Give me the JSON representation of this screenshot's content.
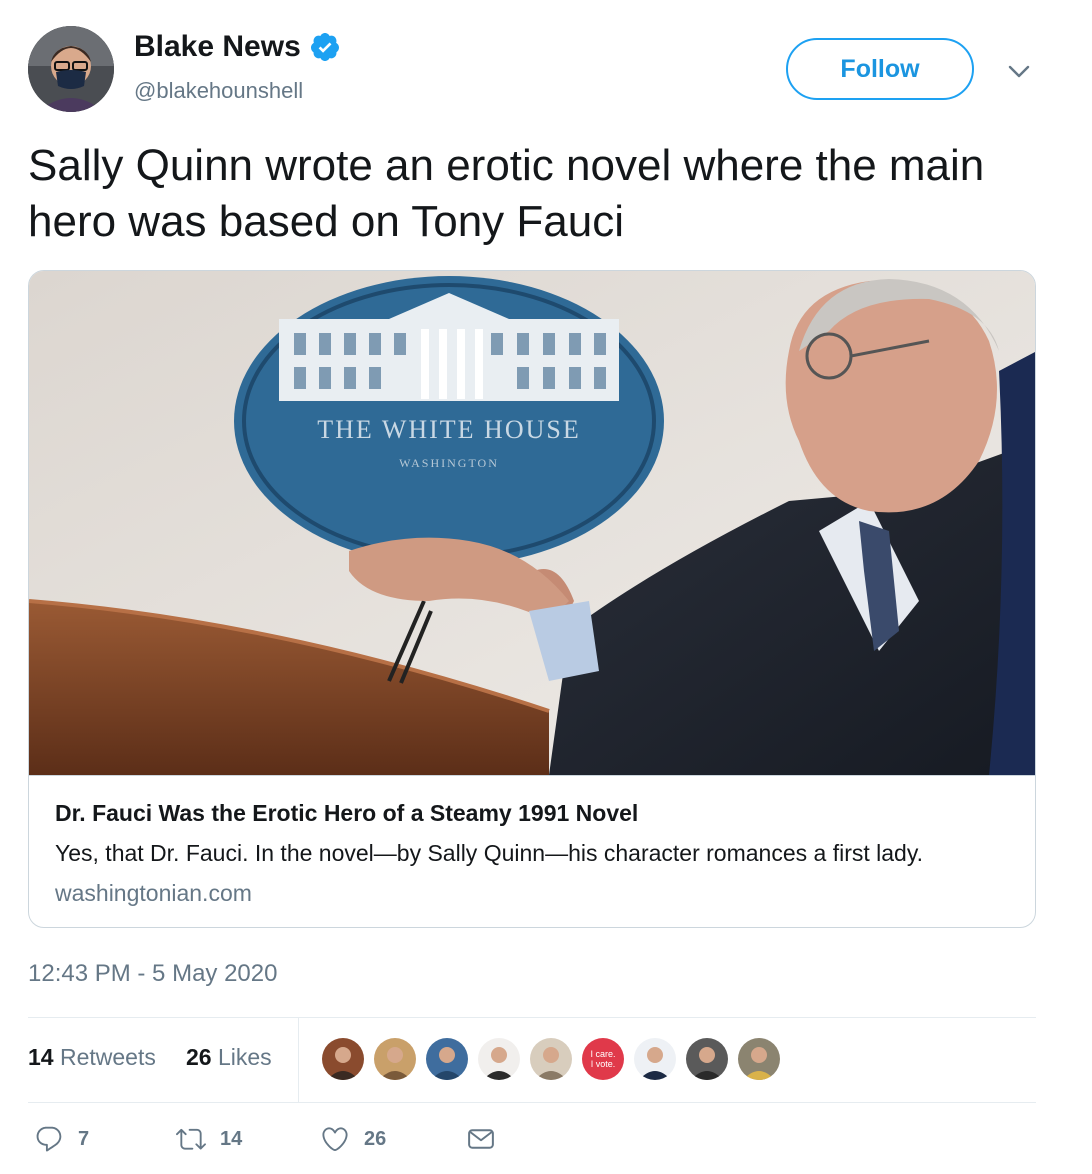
{
  "author": {
    "display_name": "Blake News",
    "handle": "@blakehounshell",
    "verified_icon": "verified-badge-icon",
    "avatar_icon": "profile-avatar"
  },
  "follow_button": {
    "label": "Follow"
  },
  "menu": {
    "icon": "chevron-down-icon"
  },
  "tweet": {
    "text": "Sally Quinn wrote an erotic novel where the main hero was based on Tony Fauci"
  },
  "card": {
    "image_sign_text": "THE WHITE HOUSE",
    "image_sign_subtext": "WASHINGTON",
    "title": "Dr. Fauci Was the Erotic Hero of a Steamy 1991 Novel",
    "description": "Yes, that Dr. Fauci. In the novel—by Sally Quinn—his character romances a first lady.",
    "domain": "washingtonian.com"
  },
  "timestamp": "12:43 PM - 5 May 2020",
  "stats": {
    "retweets_count": "14",
    "retweets_label": "Retweets",
    "likes_count": "26",
    "likes_label": "Likes"
  },
  "liker_avatars": [
    {
      "color": "#8a4b2e",
      "shirt": "#3a2a22"
    },
    {
      "color": "#c9a06a",
      "shirt": "#7a5a3a"
    },
    {
      "color": "#3f6d9e",
      "shirt": "#24466a"
    },
    {
      "color": "#f1efed",
      "shirt": "#2b2b2b"
    },
    {
      "color": "#d8cdbd",
      "shirt": "#8a7a66"
    },
    {
      "color": "#e0394a",
      "text1": "I care.",
      "text2": "I vote."
    },
    {
      "color": "#eef1f5",
      "shirt": "#1c2a44"
    },
    {
      "color": "#5a5a5a",
      "shirt": "#2a2a2a"
    },
    {
      "color": "#8b8470",
      "shirt": "#d9b24a"
    }
  ],
  "actions": {
    "reply_count": "7",
    "retweet_count": "14",
    "like_count": "26"
  },
  "colors": {
    "accent": "#1da1f2",
    "secondary_text": "#657786",
    "border": "#ccd6dd"
  }
}
